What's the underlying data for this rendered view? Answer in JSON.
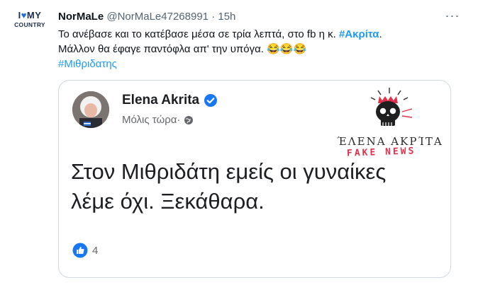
{
  "account_logo": {
    "line1_left": "I",
    "line1_right": "MY",
    "line2": "COUNTRY"
  },
  "tweet": {
    "author_name": "NorMaLe",
    "author_handle": "@NorMaLe47268991",
    "separator": "·",
    "time": "15h",
    "text_part1": "Το ανέβασε και το κατέβασε μέσα σε τρία λεπτά, στο fb η κ. ",
    "hashtag1": "#Ακρίτα",
    "text_part2": ".",
    "text_line2": "Μάλλον θα έφαγε παντόφλα απ' την υπόγα. 😂😂😂",
    "hashtag2": "#Μιθριδατης",
    "more_label": "···"
  },
  "embedded_post": {
    "author_name": "Elena Akrita",
    "time": "Μόλις τώρα",
    "time_separator": " · ",
    "text": "Στον Μιθριδάτη εμείς οι γυναίκες λέμε όχι. Ξεκάθαρα.",
    "reaction_count": "4",
    "watermark_title": "ΈΛΕΝΑ ΑΚΡΊΤΑ",
    "watermark_stamp": "FAKE NEWS"
  },
  "colors": {
    "link": "#1d9bf0",
    "facebook_blue": "#1877f2",
    "stamp_red": "#e0314b"
  },
  "icons": [
    "heart-icon",
    "more-icon",
    "verified-icon",
    "globe-icon",
    "like-icon",
    "skull-icon"
  ]
}
